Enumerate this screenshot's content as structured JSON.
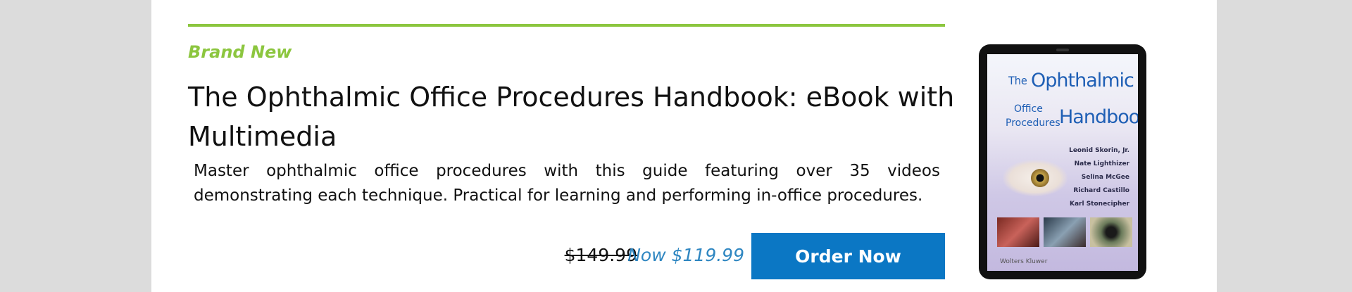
{
  "product": {
    "badge": "Brand New",
    "title": "The Ophthalmic Office Procedures Handbook: eBook with Multimedia",
    "description": "Master ophthalmic office procedures with this guide featuring over 35 videos demonstrating each technique. Practical for learning and performing in-office procedures.",
    "old_price": "$149.99",
    "new_price": "Now $119.99",
    "order_label": "Order Now"
  },
  "cover": {
    "the": "The",
    "ophthalmic": "Ophthalmic",
    "office": "Office",
    "procedures": "Procedures",
    "handbook": "Handbook",
    "authors": [
      "Leonid Skorin, Jr.",
      "Nate Lighthizer",
      "Selina McGee",
      "Richard Castillo",
      "Karl Stonecipher"
    ],
    "publisher": "Wolters Kluwer"
  },
  "colors": {
    "accent_green": "#8cc63f",
    "button_blue": "#0b77c4",
    "price_blue": "#2e86c1"
  }
}
